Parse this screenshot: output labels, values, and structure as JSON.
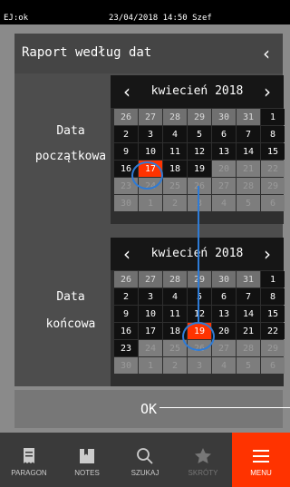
{
  "status": {
    "mode": "EJ:ok",
    "datetime": "23/04/2018 14:50 Szef"
  },
  "header": {
    "title": "Raport według dat",
    "back_icon": "chevron-left-icon"
  },
  "start": {
    "label_line1": "Data",
    "label_line2": "początkowa",
    "month": "kwiecień 2018",
    "selected": "17",
    "days": [
      [
        "26",
        "other"
      ],
      [
        "27",
        "other"
      ],
      [
        "28",
        "other"
      ],
      [
        "29",
        "other"
      ],
      [
        "30",
        "other"
      ],
      [
        "31",
        "other"
      ],
      [
        "1",
        "cur"
      ],
      [
        "2",
        "cur"
      ],
      [
        "3",
        "cur"
      ],
      [
        "4",
        "cur"
      ],
      [
        "5",
        "cur"
      ],
      [
        "6",
        "cur"
      ],
      [
        "7",
        "cur"
      ],
      [
        "8",
        "cur"
      ],
      [
        "9",
        "cur"
      ],
      [
        "10",
        "cur"
      ],
      [
        "11",
        "cur"
      ],
      [
        "12",
        "cur"
      ],
      [
        "13",
        "cur"
      ],
      [
        "14",
        "cur"
      ],
      [
        "15",
        "cur"
      ],
      [
        "16",
        "cur"
      ],
      [
        "17",
        "sel"
      ],
      [
        "18",
        "cur"
      ],
      [
        "19",
        "cur"
      ],
      [
        "20",
        "dis"
      ],
      [
        "21",
        "dis"
      ],
      [
        "22",
        "dis"
      ],
      [
        "23",
        "dis"
      ],
      [
        "24",
        "dis"
      ],
      [
        "25",
        "dis"
      ],
      [
        "26",
        "dis"
      ],
      [
        "27",
        "dis"
      ],
      [
        "28",
        "dis"
      ],
      [
        "29",
        "dis"
      ],
      [
        "30",
        "dis"
      ],
      [
        "1",
        "dis"
      ],
      [
        "2",
        "dis"
      ],
      [
        "3",
        "dis"
      ],
      [
        "4",
        "dis"
      ],
      [
        "5",
        "dis"
      ],
      [
        "6",
        "dis"
      ]
    ]
  },
  "end": {
    "label_line1": "Data",
    "label_line2": "końcowa",
    "month": "kwiecień 2018",
    "selected": "19",
    "days": [
      [
        "26",
        "other"
      ],
      [
        "27",
        "other"
      ],
      [
        "28",
        "other"
      ],
      [
        "29",
        "other"
      ],
      [
        "30",
        "other"
      ],
      [
        "31",
        "other"
      ],
      [
        "1",
        "cur"
      ],
      [
        "2",
        "cur"
      ],
      [
        "3",
        "cur"
      ],
      [
        "4",
        "cur"
      ],
      [
        "5",
        "cur"
      ],
      [
        "6",
        "cur"
      ],
      [
        "7",
        "cur"
      ],
      [
        "8",
        "cur"
      ],
      [
        "9",
        "cur"
      ],
      [
        "10",
        "cur"
      ],
      [
        "11",
        "cur"
      ],
      [
        "12",
        "cur"
      ],
      [
        "13",
        "cur"
      ],
      [
        "14",
        "cur"
      ],
      [
        "15",
        "cur"
      ],
      [
        "16",
        "cur"
      ],
      [
        "17",
        "cur"
      ],
      [
        "18",
        "cur"
      ],
      [
        "19",
        "sel"
      ],
      [
        "20",
        "cur"
      ],
      [
        "21",
        "cur"
      ],
      [
        "22",
        "cur"
      ],
      [
        "23",
        "cur"
      ],
      [
        "24",
        "dis"
      ],
      [
        "25",
        "dis"
      ],
      [
        "26",
        "dis"
      ],
      [
        "27",
        "dis"
      ],
      [
        "28",
        "dis"
      ],
      [
        "29",
        "dis"
      ],
      [
        "30",
        "dis"
      ],
      [
        "1",
        "dis"
      ],
      [
        "2",
        "dis"
      ],
      [
        "3",
        "dis"
      ],
      [
        "4",
        "dis"
      ],
      [
        "5",
        "dis"
      ],
      [
        "6",
        "dis"
      ]
    ]
  },
  "ok_label": "OK",
  "nav": [
    {
      "label": "PARAGON",
      "icon": "receipt-icon",
      "state": "normal"
    },
    {
      "label": "NOTES",
      "icon": "notebook-icon",
      "state": "normal"
    },
    {
      "label": "SZUKAJ",
      "icon": "search-icon",
      "state": "normal"
    },
    {
      "label": "SKRÓTY",
      "icon": "star-icon",
      "state": "dim"
    },
    {
      "label": "MENU",
      "icon": "menu-icon",
      "state": "active"
    }
  ],
  "colors": {
    "accent": "#ff3300",
    "highlight": "#2e7bd6"
  }
}
